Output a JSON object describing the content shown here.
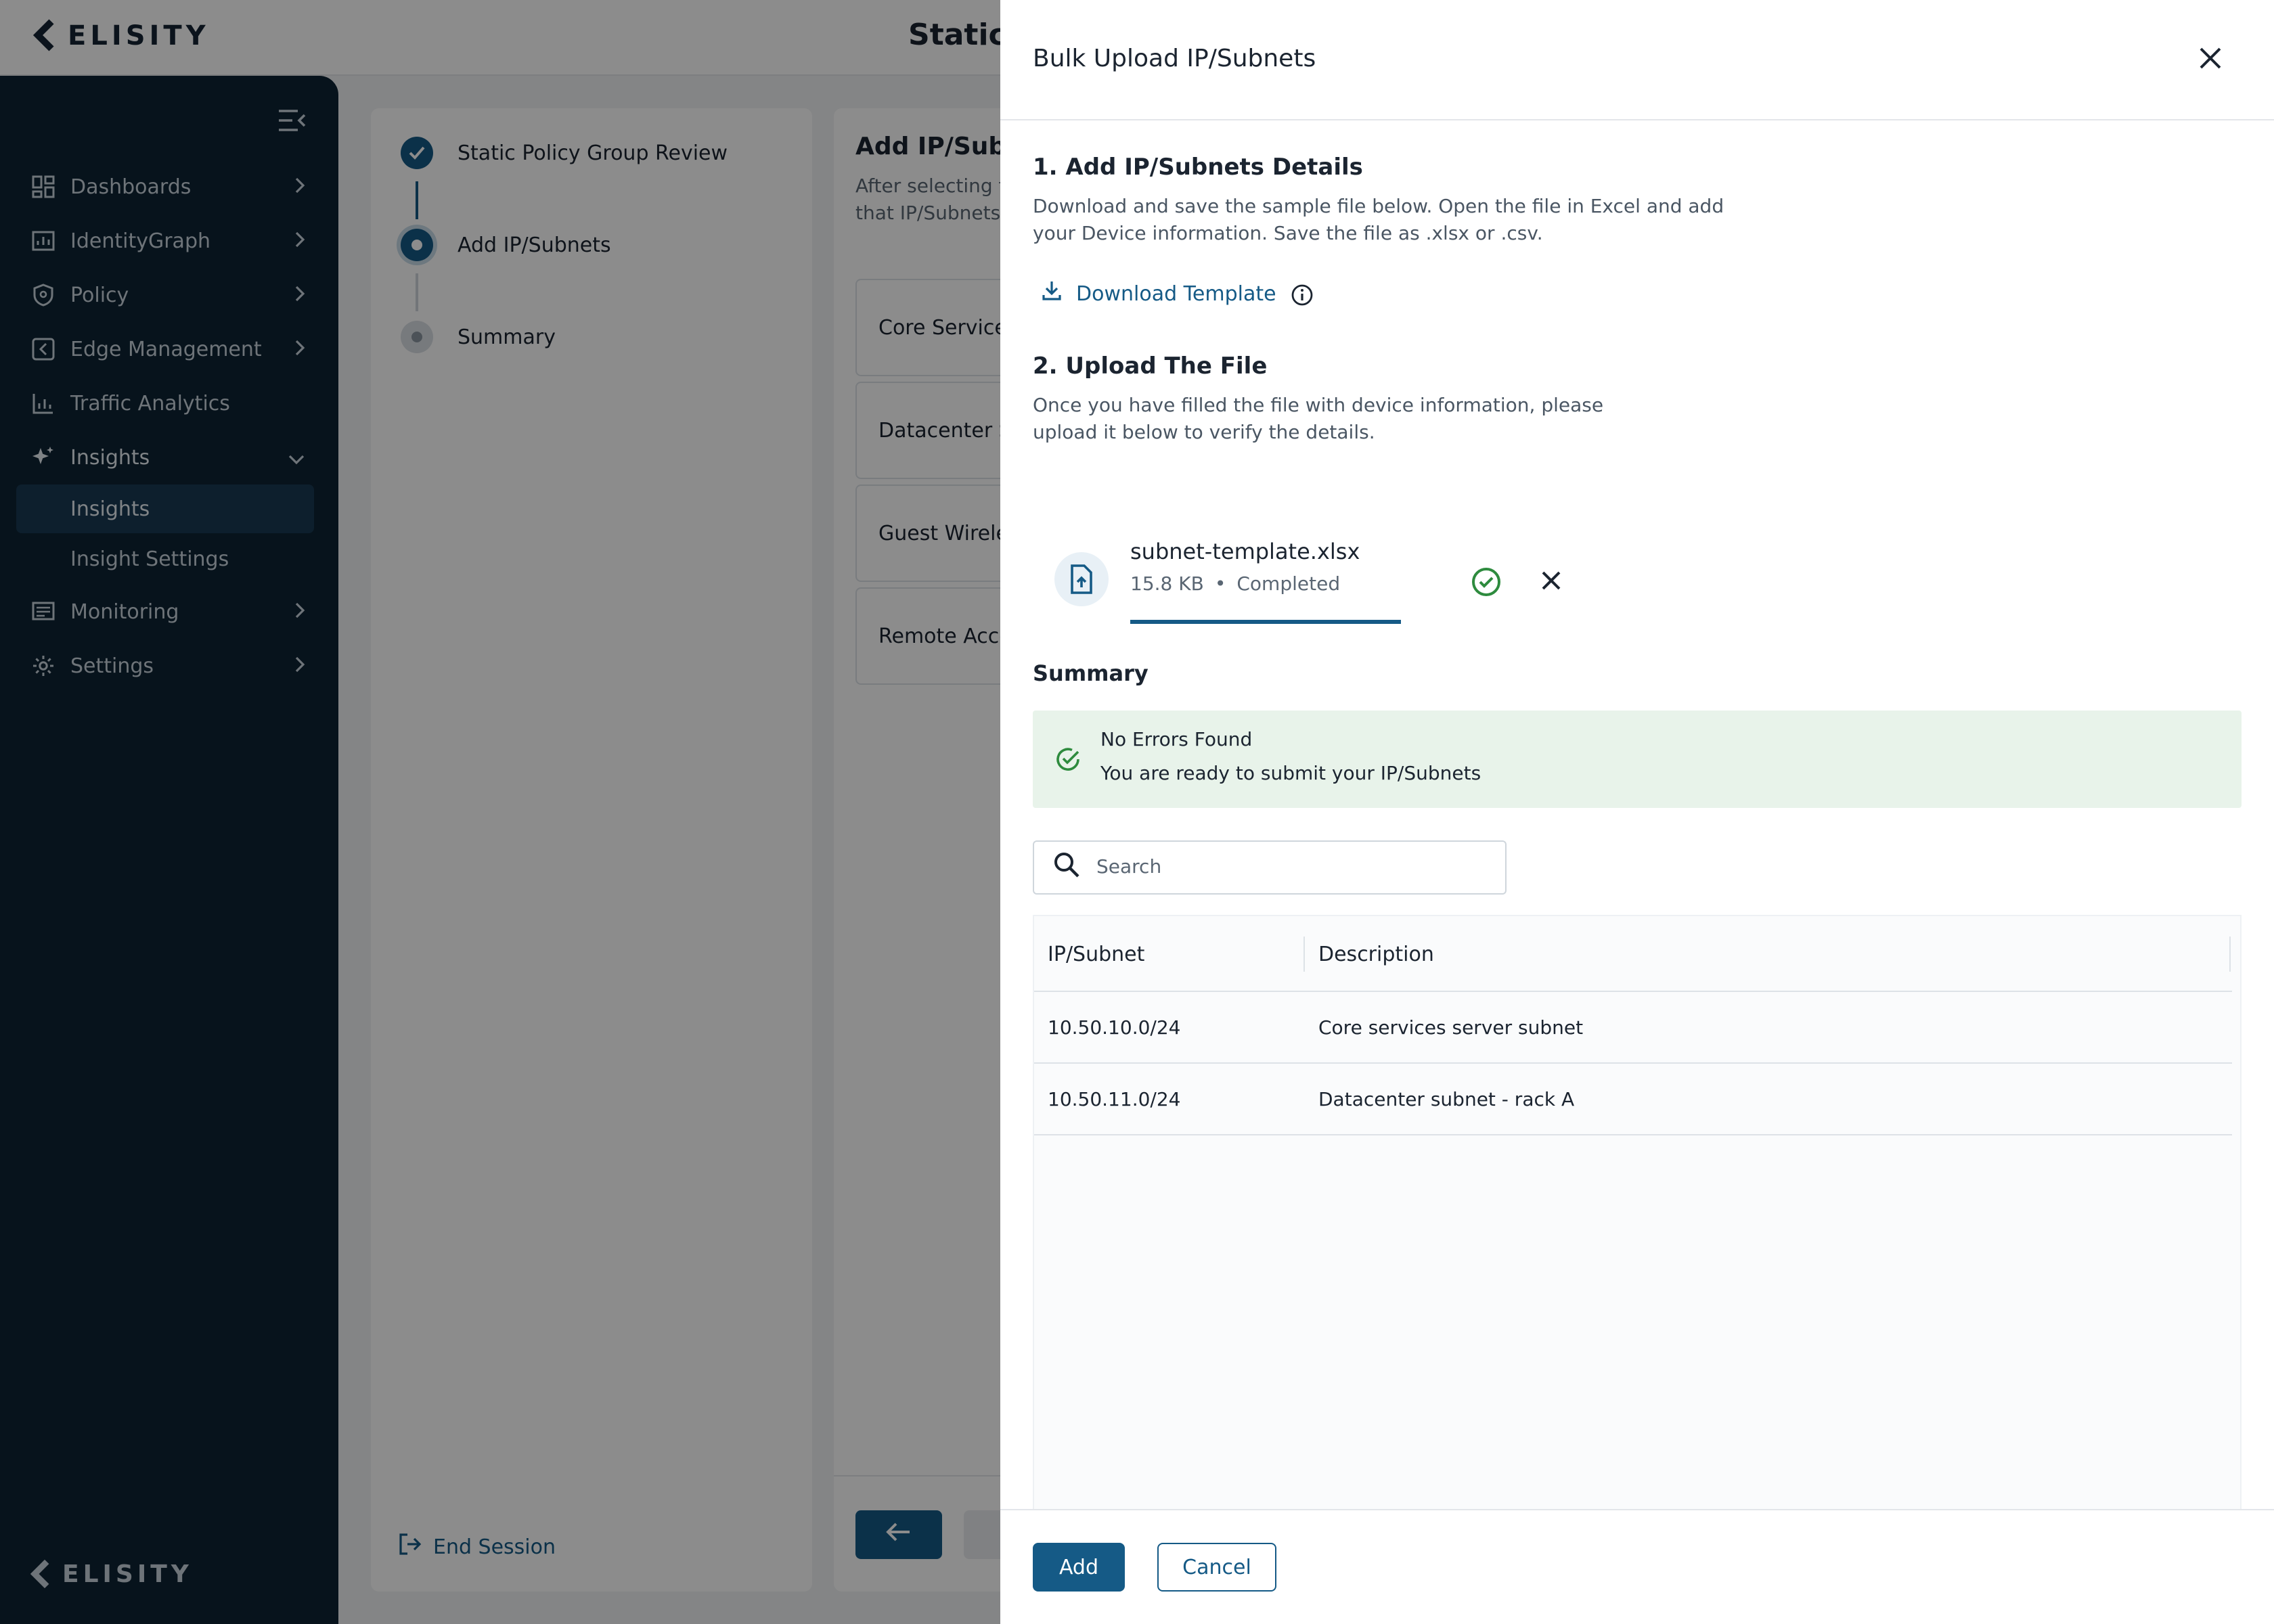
{
  "app": {
    "logo_text": "ELISITY",
    "page_title": "Static"
  },
  "sidebar": {
    "items": [
      {
        "label": "Dashboards",
        "icon": "dashboard-icon"
      },
      {
        "label": "IdentityGraph",
        "icon": "identity-graph-icon"
      },
      {
        "label": "Policy",
        "icon": "shield-icon"
      },
      {
        "label": "Edge Management",
        "icon": "edge-icon"
      },
      {
        "label": "Traffic Analytics",
        "icon": "bar-chart-icon"
      },
      {
        "label": "Insights",
        "icon": "sparkle-icon"
      },
      {
        "label": "Monitoring",
        "icon": "monitor-icon"
      },
      {
        "label": "Settings",
        "icon": "gear-icon"
      }
    ],
    "sub_items": [
      {
        "label": "Insights",
        "active": true
      },
      {
        "label": "Insight Settings",
        "active": false
      }
    ],
    "footer_logo": "ELISITY"
  },
  "steps": {
    "items": [
      {
        "label": "Static Policy Group Review",
        "status": "completed"
      },
      {
        "label": "Add IP/Subnets",
        "status": "current"
      },
      {
        "label": "Summary",
        "status": "pending"
      }
    ],
    "end_session": "End Session"
  },
  "main": {
    "title": "Add IP/Subnets",
    "desc_line1": "After selecting t",
    "desc_line2": "that IP/Subnets",
    "groups": [
      "Core Services",
      "Datacenter S",
      "Guest Wirele",
      "Remote Acce"
    ]
  },
  "drawer": {
    "title": "Bulk Upload IP/Subnets",
    "section1": {
      "title": "1. Add IP/Subnets Details",
      "desc_line1": "Download and save the sample file below. Open the file in Excel and add",
      "desc_line2": "your Device information. Save the file as .xlsx or .csv.",
      "download_label": "Download Template"
    },
    "section2": {
      "title": "2. Upload The File",
      "desc_line1": "Once you have filled the file with device information, please",
      "desc_line2": "upload it below to verify the details."
    },
    "file": {
      "name": "subnet-template.xlsx",
      "size": "15.8 KB",
      "separator": "•",
      "status": "Completed",
      "progress": 1.0
    },
    "summary": {
      "title": "Summary",
      "alert_title": "No Errors Found",
      "alert_text": "You are ready to submit your IP/Subnets"
    },
    "search": {
      "placeholder": "Search",
      "value": ""
    },
    "table": {
      "columns": [
        "IP/Subnet",
        "Description"
      ],
      "rows": [
        [
          "10.50.10.0/24",
          "Core services server subnet"
        ],
        [
          "10.50.11.0/24",
          "Datacenter subnet - rack A"
        ]
      ]
    },
    "buttons": {
      "add": "Add",
      "cancel": "Cancel"
    }
  },
  "colors": {
    "primary": "#155a86",
    "sidebar_bg": "#0e2434",
    "success": "#2e8b3e",
    "success_bg": "#e8f3ea"
  }
}
